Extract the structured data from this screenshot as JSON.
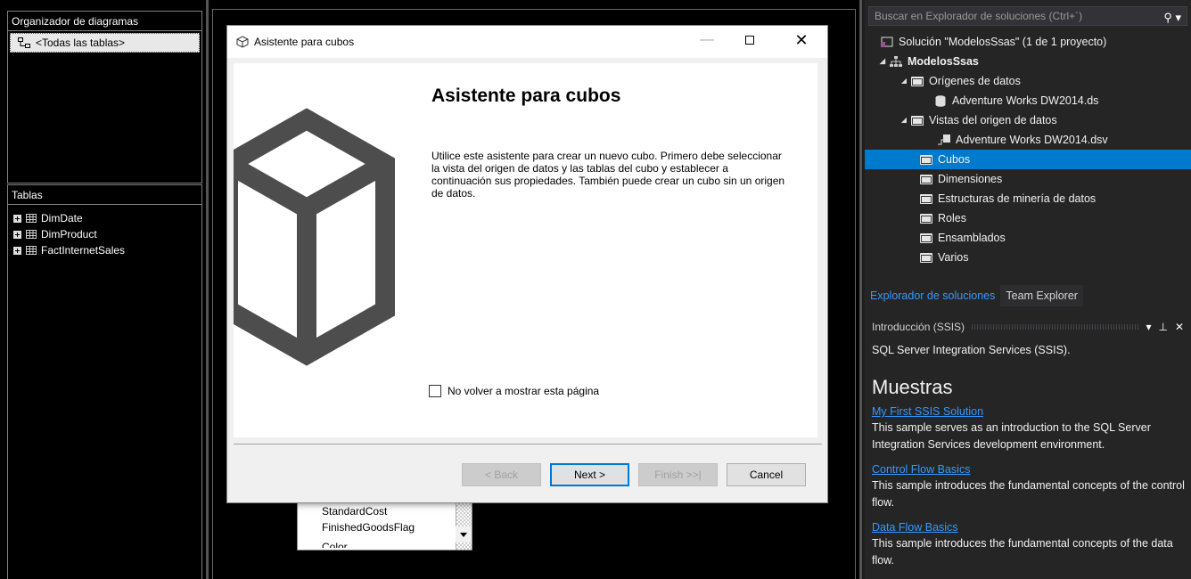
{
  "diagram_organizer": {
    "header": "Organizador de diagramas",
    "selected_item": "<Todas las tablas>"
  },
  "tables_panel": {
    "header": "Tablas",
    "items": [
      "DimDate",
      "DimProduct",
      "FactInternetSales"
    ]
  },
  "column_list": {
    "items": [
      "StandardCost",
      "FinishedGoodsFlag",
      "Color"
    ]
  },
  "dialog": {
    "title": "Asistente para cubos",
    "heading": "Asistente para cubos",
    "description": "Utilice este asistente para crear un nuevo cubo. Primero debe seleccionar la vista del origen de datos y las tablas del cubo y establecer a continuación sus propiedades. También puede crear un cubo sin un origen de datos.",
    "checkbox_label": "No volver a mostrar esta página",
    "checkbox_checked": false,
    "buttons": {
      "back": "< Back",
      "next": "Next >",
      "finish": "Finish >>|",
      "cancel": "Cancel"
    }
  },
  "solution_explorer": {
    "search_placeholder": "Buscar en Explorador de soluciones (Ctrl+´)",
    "tree": [
      {
        "label": "Solución \"ModelosSsas\" (1 de 1 proyecto)",
        "icon": "solution-icon"
      },
      {
        "label": "ModelosSsas",
        "icon": "project-icon"
      },
      {
        "label": "Orígenes de datos",
        "icon": "folder-icon"
      },
      {
        "label": "Adventure Works DW2014.ds",
        "icon": "datasource-icon"
      },
      {
        "label": "Vistas del origen de datos",
        "icon": "folder-icon"
      },
      {
        "label": "Adventure Works DW2014.dsv",
        "icon": "dsv-icon"
      },
      {
        "label": "Cubos",
        "icon": "folder-icon"
      },
      {
        "label": "Dimensiones",
        "icon": "folder-icon"
      },
      {
        "label": "Estructuras de minería de datos",
        "icon": "folder-icon"
      },
      {
        "label": "Roles",
        "icon": "folder-icon"
      },
      {
        "label": "Ensamblados",
        "icon": "folder-icon"
      },
      {
        "label": "Varios",
        "icon": "folder-icon"
      }
    ],
    "tabs": [
      "Explorador de soluciones",
      "Team Explorer"
    ]
  },
  "intro_panel": {
    "header": "Introducción (SSIS)",
    "subtitle": "SQL Server Integration Services (SSIS).",
    "section_title": "Muestras",
    "samples": [
      {
        "link": "My First SSIS Solution",
        "desc": "This sample serves as an introduction to the SQL Server Integration Services development environment."
      },
      {
        "link": "Control Flow Basics",
        "desc": "This sample introduces the fundamental concepts of the control flow."
      },
      {
        "link": "Data Flow Basics",
        "desc": "This sample introduces the fundamental concepts of the data flow."
      }
    ]
  },
  "colors": {
    "accent": "#007acc",
    "link": "#3399ff"
  }
}
